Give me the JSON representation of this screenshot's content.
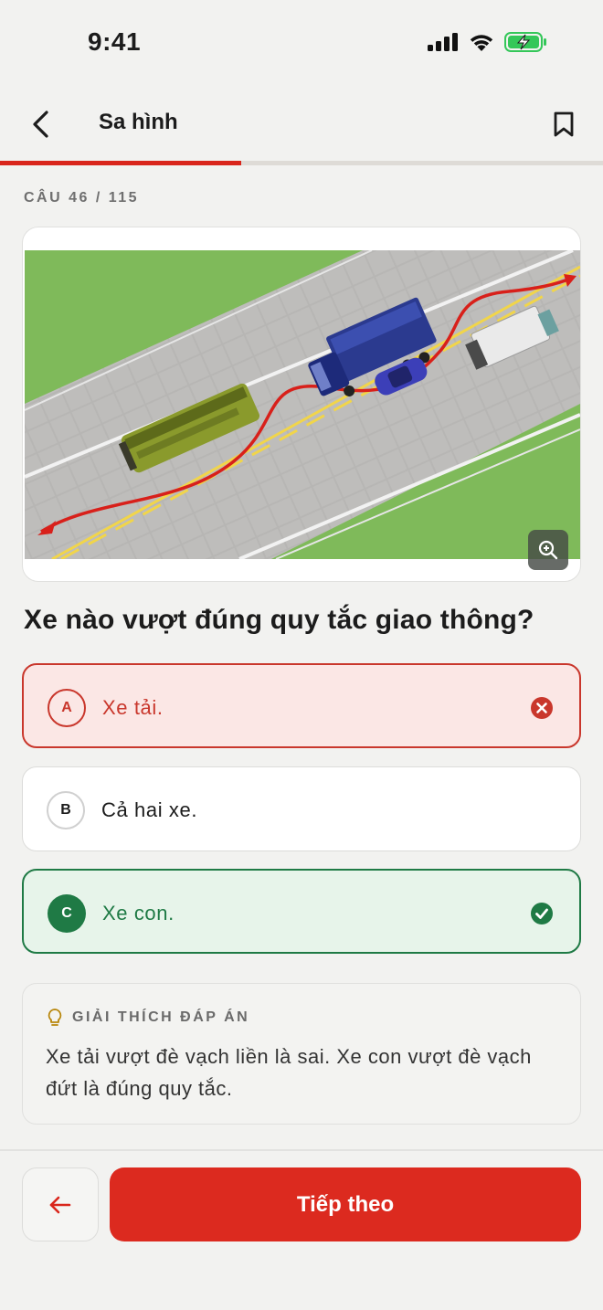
{
  "status_bar": {
    "time": "9:41",
    "icons": [
      "signal-icon",
      "wifi-icon",
      "battery-charging-icon"
    ]
  },
  "header": {
    "title": "Sa hình",
    "back_icon": "chevron-left-icon",
    "bookmark_icon": "bookmark-icon"
  },
  "progress": {
    "current": 46,
    "total": 115,
    "fraction": 0.4
  },
  "question": {
    "counter": "CÂU 46 / 115",
    "text": "Xe nào vượt đúng quy tắc giao thông?",
    "zoom_icon": "zoom-in-icon"
  },
  "options": [
    {
      "letter": "A",
      "text": "Xe tải.",
      "state": "wrong",
      "icon": "x-circle-icon"
    },
    {
      "letter": "B",
      "text": "Cả hai xe.",
      "state": "neutral"
    },
    {
      "letter": "C",
      "text": "Xe con.",
      "state": "correct",
      "icon": "check-circle-icon"
    }
  ],
  "explanation": {
    "label": "GIẢI THÍCH ĐÁP ÁN",
    "icon": "lightbulb-icon",
    "text": "Xe tải vượt đè vạch liền là sai. Xe con vượt đè vạch đứt là đúng quy tắc."
  },
  "footer": {
    "prev_icon": "arrow-left-icon",
    "next_label": "Tiếp theo"
  },
  "colors": {
    "accent_red": "#dc2a1f",
    "wrong_red": "#c9372c",
    "correct_green": "#1f7a45",
    "background": "#f2f2f0"
  }
}
